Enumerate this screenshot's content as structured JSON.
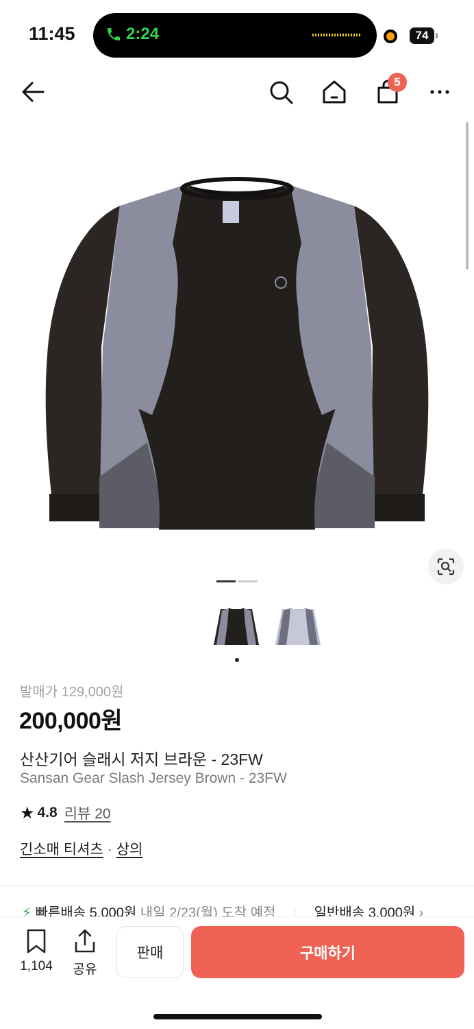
{
  "status": {
    "time": "11:45",
    "call_time": "2:24",
    "battery": "74"
  },
  "nav": {
    "cart_count": "5"
  },
  "gallery": {
    "image_count": 2,
    "current_index": 1
  },
  "product": {
    "original_price": "발매가 129,000원",
    "price": "200,000원",
    "name_ko": "산산기어 슬래시 저지 브라운 - 23FW",
    "name_en": "Sansan Gear Slash Jersey Brown - 23FW",
    "rating_star": "★",
    "rating": "4.8",
    "review_label": "리뷰 20",
    "category_1": "긴소매 티셔츠",
    "category_sep": "·",
    "category_2": "상의"
  },
  "shipping": {
    "bolt": "⚡",
    "fast_label": "빠른배송 5,000원",
    "fast_eta": "내일 2/23(월) 도착 예정",
    "normal_label": "일반배송 3,000원",
    "chevron": "›"
  },
  "bottom": {
    "bookmark_count": "1,104",
    "share_label": "공유",
    "sell_label": "판매",
    "buy_label": "구매하기"
  },
  "colors": {
    "accent": "#ef6253",
    "bolt": "#22b14c",
    "call_green": "#32d74b"
  }
}
